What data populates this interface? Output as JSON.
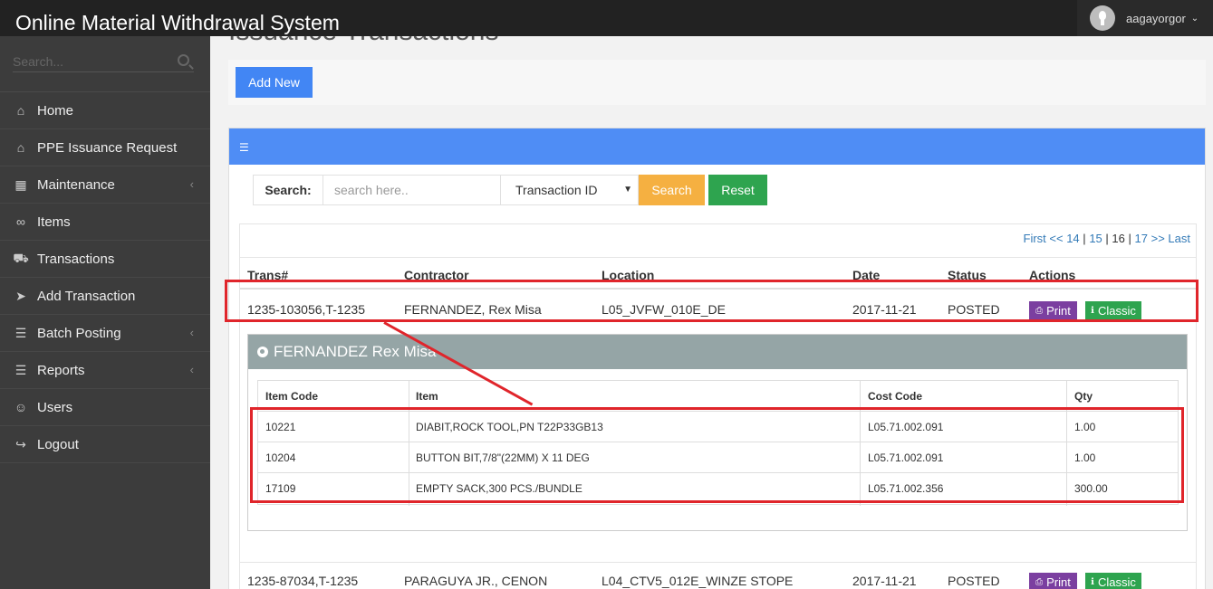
{
  "app": {
    "title": "Online Material Withdrawal System"
  },
  "user": {
    "name": "aagayorgor"
  },
  "sidebar": {
    "search_placeholder": "Search...",
    "items": [
      {
        "label": "Home",
        "icon": "home-icon"
      },
      {
        "label": "PPE Issuance Request",
        "icon": "home-icon"
      },
      {
        "label": "Maintenance",
        "icon": "grid-icon",
        "has_submenu": true
      },
      {
        "label": "Items",
        "icon": "link-icon"
      },
      {
        "label": "Transactions",
        "icon": "truck-icon"
      },
      {
        "label": "Add Transaction",
        "icon": "paper-plane-icon"
      },
      {
        "label": "Batch Posting",
        "icon": "list-icon",
        "has_submenu": true
      },
      {
        "label": "Reports",
        "icon": "list-icon",
        "has_submenu": true
      },
      {
        "label": "Users",
        "icon": "users-icon"
      },
      {
        "label": "Logout",
        "icon": "logout-icon"
      }
    ]
  },
  "page": {
    "heading": "Issuance Transactions"
  },
  "toolbar": {
    "add_new": "Add New"
  },
  "search": {
    "label": "Search:",
    "placeholder": "search here..",
    "filter_selected": "Transaction ID",
    "search_button": "Search",
    "reset_button": "Reset"
  },
  "pagination": {
    "first": "First <<",
    "p14": "14",
    "p15": "15",
    "p16": "16",
    "p17": "17",
    "last": ">> Last",
    "sep": "|"
  },
  "table": {
    "headers": {
      "trans": "Trans#",
      "contractor": "Contractor",
      "location": "Location",
      "date": "Date",
      "status": "Status",
      "actions": "Actions"
    },
    "rows": [
      {
        "trans": "1235-103056,T-1235",
        "contractor": "FERNANDEZ, Rex Misa",
        "location": "L05_JVFW_010E_DE",
        "date": "2017-11-21",
        "status": "POSTED"
      },
      {
        "trans": "1235-87034,T-1235",
        "contractor": "PARAGUYA JR., CENON",
        "location": "L04_CTV5_012E_WINZE STOPE",
        "date": "2017-11-21",
        "status": "POSTED"
      }
    ],
    "print_label": "Print",
    "classic_label": "Classic"
  },
  "detail": {
    "title": "FERNANDEZ Rex Misa",
    "headers": {
      "item_code": "Item Code",
      "item": "Item",
      "cost_code": "Cost Code",
      "qty": "Qty"
    },
    "items": [
      {
        "item_code": "10221",
        "item": "DIABIT,ROCK TOOL,PN T22P33GB13",
        "cost_code": "L05.71.002.091",
        "qty": "1.00"
      },
      {
        "item_code": "10204",
        "item": "BUTTON BIT,7/8\"(22MM) X 11 DEG",
        "cost_code": "L05.71.002.091",
        "qty": "1.00"
      },
      {
        "item_code": "17109",
        "item": "EMPTY SACK,300 PCS./BUNDLE",
        "cost_code": "L05.71.002.356",
        "qty": "300.00"
      }
    ]
  },
  "colors": {
    "accent_blue": "#4f8df5",
    "highlight_red": "#e0252b",
    "print_purple": "#7b3fa0",
    "classic_green": "#2ea44f",
    "search_orange": "#f5b041"
  }
}
